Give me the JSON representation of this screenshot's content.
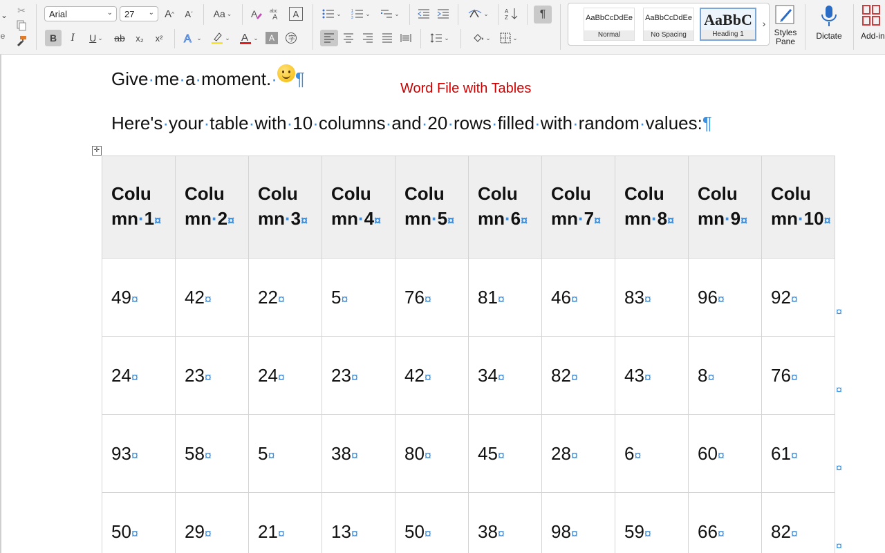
{
  "ribbon": {
    "font_name": "Arial",
    "font_size": "27",
    "change_case_label": "Aa",
    "bold_label": "B",
    "italic_label": "I",
    "underline_label": "U",
    "strike_label": "ab",
    "subscript_label": "x₂",
    "superscript_label": "x²",
    "pilcrow_label": "¶",
    "styles": [
      {
        "preview": "AaBbCcDdEe",
        "label": "Normal"
      },
      {
        "preview": "AaBbCcDdEe",
        "label": "No Spacing"
      },
      {
        "preview": "AaBbC",
        "label": "Heading 1"
      }
    ],
    "styles_pane_label": "Styles\nPane",
    "dictate_label": "Dictate",
    "addins_label": "Add-ins"
  },
  "document": {
    "line1_words": [
      "Give",
      "me",
      "a",
      "moment."
    ],
    "red_note": "Word File with Tables",
    "line2_words": [
      "Here's",
      "your",
      "table",
      "with",
      "10",
      "columns",
      "and",
      "20",
      "rows",
      "filled",
      "with",
      "random",
      "values:"
    ],
    "pilcrow": "¶",
    "dot": "·",
    "cell_marker": "¤"
  },
  "table": {
    "headers": [
      [
        "Colu",
        "mn",
        "1"
      ],
      [
        "Colu",
        "mn",
        "2"
      ],
      [
        "Colu",
        "mn",
        "3"
      ],
      [
        "Colu",
        "mn",
        "4"
      ],
      [
        "Colu",
        "mn",
        "5"
      ],
      [
        "Colu",
        "mn",
        "6"
      ],
      [
        "Colu",
        "mn",
        "7"
      ],
      [
        "Colu",
        "mn",
        "8"
      ],
      [
        "Colu",
        "mn",
        "9"
      ],
      [
        "Colu",
        "mn",
        "10"
      ]
    ],
    "rows": [
      [
        "49",
        "42",
        "22",
        "5",
        "76",
        "81",
        "46",
        "83",
        "96",
        "92"
      ],
      [
        "24",
        "23",
        "24",
        "23",
        "42",
        "34",
        "82",
        "43",
        "8",
        "76"
      ],
      [
        "93",
        "58",
        "5",
        "38",
        "80",
        "45",
        "28",
        "6",
        "60",
        "61"
      ],
      [
        "50",
        "29",
        "21",
        "13",
        "50",
        "38",
        "98",
        "59",
        "66",
        "82"
      ]
    ]
  },
  "colors": {
    "accent": "#3b8fe0",
    "note_red": "#cc0000",
    "header_bg": "#efefef"
  }
}
